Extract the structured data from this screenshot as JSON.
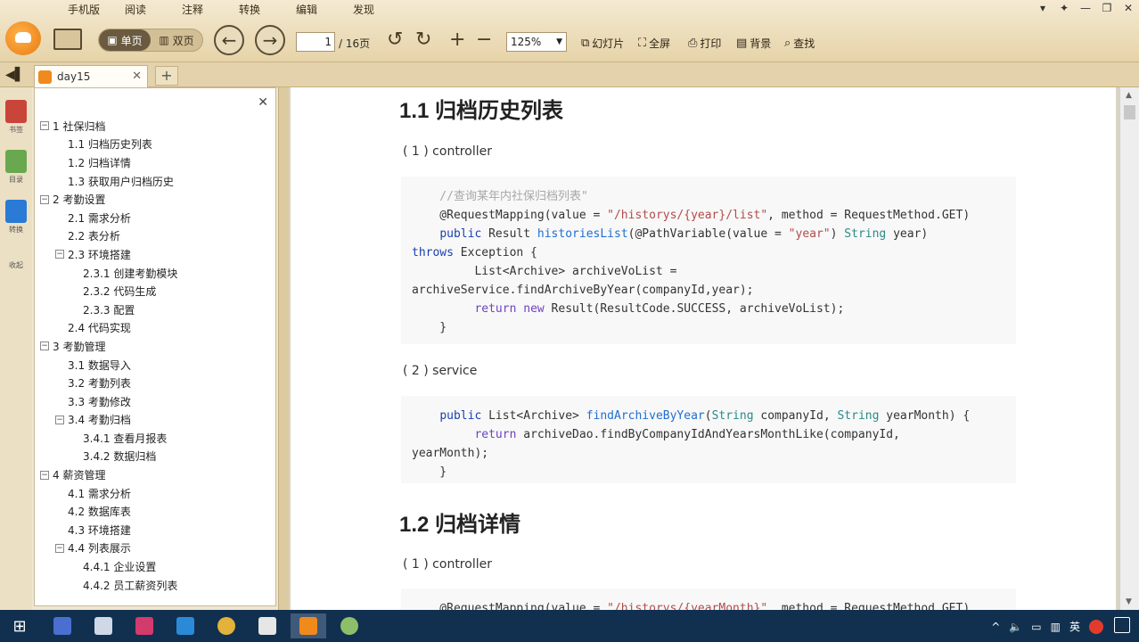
{
  "menu": [
    "手机版",
    "阅读",
    "注释",
    "转换",
    "编辑",
    "发现"
  ],
  "window_controls": [
    "▾",
    "✦",
    "—",
    "❐",
    "✕"
  ],
  "toolbar": {
    "single_page": "单页",
    "double_page": "双页",
    "page_current": "1",
    "page_total": "/ 16页",
    "zoom": "125%",
    "slideshow": "幻灯片",
    "fullscreen": "全屏",
    "print": "打印",
    "background": "背景",
    "find": "查找"
  },
  "tabs": [
    {
      "label": "day15"
    }
  ],
  "rail": [
    {
      "label": "书签",
      "color": "#c9453a"
    },
    {
      "label": "目录",
      "color": "#6aa84f"
    },
    {
      "label": "转换",
      "color": "#2a7ad6"
    },
    {
      "label": "收起",
      "color": "#999999"
    }
  ],
  "outline": [
    {
      "text": "1 社保归档",
      "level": 0,
      "toggle": "−"
    },
    {
      "text": "1.1 归档历史列表",
      "level": 1,
      "toggle": ""
    },
    {
      "text": "1.2 归档详情",
      "level": 1,
      "toggle": ""
    },
    {
      "text": "1.3 获取用户归档历史",
      "level": 1,
      "toggle": ""
    },
    {
      "text": "2 考勤设置",
      "level": 0,
      "toggle": "−"
    },
    {
      "text": "2.1 需求分析",
      "level": 1,
      "toggle": ""
    },
    {
      "text": "2.2 表分析",
      "level": 1,
      "toggle": ""
    },
    {
      "text": "2.3 环境搭建",
      "level": 1,
      "toggle": "−"
    },
    {
      "text": "2.3.1 创建考勤模块",
      "level": 2,
      "toggle": ""
    },
    {
      "text": "2.3.2 代码生成",
      "level": 2,
      "toggle": ""
    },
    {
      "text": "2.3.3 配置",
      "level": 2,
      "toggle": ""
    },
    {
      "text": "2.4 代码实现",
      "level": 1,
      "toggle": ""
    },
    {
      "text": "3 考勤管理",
      "level": 0,
      "toggle": "−"
    },
    {
      "text": "3.1 数据导入",
      "level": 1,
      "toggle": ""
    },
    {
      "text": "3.2 考勤列表",
      "level": 1,
      "toggle": ""
    },
    {
      "text": "3.3 考勤修改",
      "level": 1,
      "toggle": ""
    },
    {
      "text": "3.4 考勤归档",
      "level": 1,
      "toggle": "−"
    },
    {
      "text": "3.4.1 查看月报表",
      "level": 2,
      "toggle": ""
    },
    {
      "text": "3.4.2 数据归档",
      "level": 2,
      "toggle": ""
    },
    {
      "text": "4 薪资管理",
      "level": 0,
      "toggle": "−"
    },
    {
      "text": "4.1 需求分析",
      "level": 1,
      "toggle": ""
    },
    {
      "text": "4.2 数据库表",
      "level": 1,
      "toggle": ""
    },
    {
      "text": "4.3 环境搭建",
      "level": 1,
      "toggle": ""
    },
    {
      "text": "4.4 列表展示",
      "level": 1,
      "toggle": "−"
    },
    {
      "text": "4.4.1 企业设置",
      "level": 2,
      "toggle": ""
    },
    {
      "text": "4.4.2 员工薪资列表",
      "level": 2,
      "toggle": ""
    }
  ],
  "doc": {
    "h1": "1.1 归档历史列表",
    "s1": "( 1 ) controller",
    "code1": [
      [
        [
          "cm",
          "    //查询某年内社保归档列表\""
        ]
      ],
      [
        [
          "",
          "    @RequestMapping(value = "
        ],
        [
          "st",
          "\"/historys/{year}/list\""
        ],
        [
          "",
          ", method = RequestMethod.GET)"
        ]
      ],
      [
        [
          "",
          "    "
        ],
        [
          "kwb",
          "public"
        ],
        [
          "",
          " Result "
        ],
        [
          "fn",
          "historiesList"
        ],
        [
          "",
          "(@PathVariable(value = "
        ],
        [
          "st",
          "\"year\""
        ],
        [
          "",
          ") "
        ],
        [
          "ty",
          "String"
        ],
        [
          "",
          " year)"
        ]
      ],
      [
        [
          "kwb",
          "throws"
        ],
        [
          "",
          " Exception {"
        ]
      ],
      [
        [
          "",
          "         List<Archive> archiveVoList ="
        ]
      ],
      [
        [
          "",
          "archiveService.findArchiveByYear(companyId,year);"
        ]
      ],
      [
        [
          "",
          "         "
        ],
        [
          "kw",
          "return"
        ],
        [
          "",
          " "
        ],
        [
          "kw",
          "new"
        ],
        [
          "",
          " Result(ResultCode.SUCCESS, archiveVoList);"
        ]
      ],
      [
        [
          "",
          "    }"
        ]
      ]
    ],
    "s2": "( 2 ) service",
    "code2": [
      [
        [
          "",
          "    "
        ],
        [
          "kwb",
          "public"
        ],
        [
          "",
          " List<Archive> "
        ],
        [
          "fn",
          "findArchiveByYear"
        ],
        [
          "",
          "("
        ],
        [
          "ty",
          "String"
        ],
        [
          "",
          " companyId, "
        ],
        [
          "ty",
          "String"
        ],
        [
          "",
          " yearMonth) {"
        ]
      ],
      [
        [
          "",
          "         "
        ],
        [
          "kw",
          "return"
        ],
        [
          "",
          " archiveDao.findByCompanyIdAndYearsMonthLike(companyId,"
        ]
      ],
      [
        [
          "",
          "yearMonth);"
        ]
      ],
      [
        [
          "",
          "    }"
        ]
      ]
    ],
    "h2": "1.2 归档详情",
    "s3": "( 1 ) controller",
    "code3": [
      [
        [
          "",
          "    @RequestMapping(value = "
        ],
        [
          "st",
          "\"/historys/{yearMonth}\""
        ],
        [
          "",
          ", method = RequestMethod.GET)"
        ]
      ]
    ]
  },
  "tray": {
    "lang": "英"
  }
}
